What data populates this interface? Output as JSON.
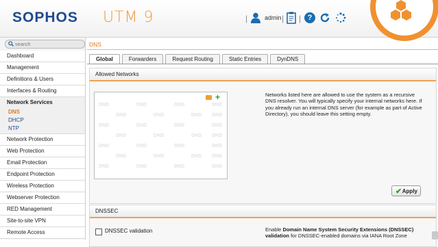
{
  "header": {
    "logo": "SOPHOS",
    "product": "UTM 9",
    "separator": "|",
    "username": "admin",
    "icons": [
      "user-icon",
      "clipboard-icon",
      "help-icon",
      "reload-icon",
      "spinner-icon"
    ],
    "help_glyph": "?",
    "accent_color": "#f0912f",
    "brand_color": "#1f4a8f"
  },
  "sidebar": {
    "search_placeholder": "search",
    "items": [
      {
        "label": "Dashboard"
      },
      {
        "label": "Management"
      },
      {
        "label": "Definitions & Users"
      },
      {
        "label": "Interfaces & Routing"
      },
      {
        "label": "Network Services"
      },
      {
        "label": "DNS"
      },
      {
        "label": "DHCP"
      },
      {
        "label": "NTP"
      },
      {
        "label": "Network Protection"
      },
      {
        "label": "Web Protection"
      },
      {
        "label": "Email Protection"
      },
      {
        "label": "Endpoint Protection"
      },
      {
        "label": "Wireless Protection"
      },
      {
        "label": "Webserver Protection"
      },
      {
        "label": "RED Management"
      },
      {
        "label": "Site-to-site VPN"
      },
      {
        "label": "Remote Access"
      }
    ]
  },
  "main": {
    "page_title": "DNS",
    "tabs": [
      {
        "label": "Global"
      },
      {
        "label": "Forwarders"
      },
      {
        "label": "Request Routing"
      },
      {
        "label": "Static Entries"
      },
      {
        "label": "DynDNS"
      }
    ],
    "allowed_networks": {
      "title": "Allowed Networks",
      "empty_watermark": "DND",
      "help_text": "Networks listed here are allowed to use the system as a recursive DNS resolver. You will typically specify your internal networks here. If you already run an internal DNS server (for example as part of Active Directory), you should leave this setting empty.",
      "apply_label": "Apply"
    },
    "dnssec": {
      "title": "DNSSEC",
      "checkbox_label": "DNSSEC validation",
      "checked": false,
      "text_prefix": "Enable ",
      "text_bold": "Domain Name System Security Extensions (DNSSEC) validation",
      "text_suffix": " for DNSSEC-enabled domains via IANA Root Zone"
    }
  }
}
